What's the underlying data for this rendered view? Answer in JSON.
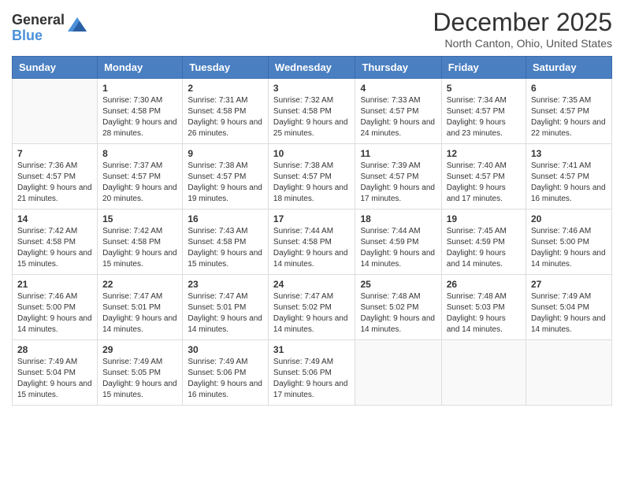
{
  "logo": {
    "general": "General",
    "blue": "Blue"
  },
  "title": "December 2025",
  "location": "North Canton, Ohio, United States",
  "days_of_week": [
    "Sunday",
    "Monday",
    "Tuesday",
    "Wednesday",
    "Thursday",
    "Friday",
    "Saturday"
  ],
  "weeks": [
    [
      {
        "day": "",
        "sunrise": "",
        "sunset": "",
        "daylight": ""
      },
      {
        "day": "1",
        "sunrise": "7:30 AM",
        "sunset": "4:58 PM",
        "daylight": "9 hours and 28 minutes."
      },
      {
        "day": "2",
        "sunrise": "7:31 AM",
        "sunset": "4:58 PM",
        "daylight": "9 hours and 26 minutes."
      },
      {
        "day": "3",
        "sunrise": "7:32 AM",
        "sunset": "4:58 PM",
        "daylight": "9 hours and 25 minutes."
      },
      {
        "day": "4",
        "sunrise": "7:33 AM",
        "sunset": "4:57 PM",
        "daylight": "9 hours and 24 minutes."
      },
      {
        "day": "5",
        "sunrise": "7:34 AM",
        "sunset": "4:57 PM",
        "daylight": "9 hours and 23 minutes."
      },
      {
        "day": "6",
        "sunrise": "7:35 AM",
        "sunset": "4:57 PM",
        "daylight": "9 hours and 22 minutes."
      }
    ],
    [
      {
        "day": "7",
        "sunrise": "7:36 AM",
        "sunset": "4:57 PM",
        "daylight": "9 hours and 21 minutes."
      },
      {
        "day": "8",
        "sunrise": "7:37 AM",
        "sunset": "4:57 PM",
        "daylight": "9 hours and 20 minutes."
      },
      {
        "day": "9",
        "sunrise": "7:38 AM",
        "sunset": "4:57 PM",
        "daylight": "9 hours and 19 minutes."
      },
      {
        "day": "10",
        "sunrise": "7:38 AM",
        "sunset": "4:57 PM",
        "daylight": "9 hours and 18 minutes."
      },
      {
        "day": "11",
        "sunrise": "7:39 AM",
        "sunset": "4:57 PM",
        "daylight": "9 hours and 17 minutes."
      },
      {
        "day": "12",
        "sunrise": "7:40 AM",
        "sunset": "4:57 PM",
        "daylight": "9 hours and 17 minutes."
      },
      {
        "day": "13",
        "sunrise": "7:41 AM",
        "sunset": "4:57 PM",
        "daylight": "9 hours and 16 minutes."
      }
    ],
    [
      {
        "day": "14",
        "sunrise": "7:42 AM",
        "sunset": "4:58 PM",
        "daylight": "9 hours and 15 minutes."
      },
      {
        "day": "15",
        "sunrise": "7:42 AM",
        "sunset": "4:58 PM",
        "daylight": "9 hours and 15 minutes."
      },
      {
        "day": "16",
        "sunrise": "7:43 AM",
        "sunset": "4:58 PM",
        "daylight": "9 hours and 15 minutes."
      },
      {
        "day": "17",
        "sunrise": "7:44 AM",
        "sunset": "4:58 PM",
        "daylight": "9 hours and 14 minutes."
      },
      {
        "day": "18",
        "sunrise": "7:44 AM",
        "sunset": "4:59 PM",
        "daylight": "9 hours and 14 minutes."
      },
      {
        "day": "19",
        "sunrise": "7:45 AM",
        "sunset": "4:59 PM",
        "daylight": "9 hours and 14 minutes."
      },
      {
        "day": "20",
        "sunrise": "7:46 AM",
        "sunset": "5:00 PM",
        "daylight": "9 hours and 14 minutes."
      }
    ],
    [
      {
        "day": "21",
        "sunrise": "7:46 AM",
        "sunset": "5:00 PM",
        "daylight": "9 hours and 14 minutes."
      },
      {
        "day": "22",
        "sunrise": "7:47 AM",
        "sunset": "5:01 PM",
        "daylight": "9 hours and 14 minutes."
      },
      {
        "day": "23",
        "sunrise": "7:47 AM",
        "sunset": "5:01 PM",
        "daylight": "9 hours and 14 minutes."
      },
      {
        "day": "24",
        "sunrise": "7:47 AM",
        "sunset": "5:02 PM",
        "daylight": "9 hours and 14 minutes."
      },
      {
        "day": "25",
        "sunrise": "7:48 AM",
        "sunset": "5:02 PM",
        "daylight": "9 hours and 14 minutes."
      },
      {
        "day": "26",
        "sunrise": "7:48 AM",
        "sunset": "5:03 PM",
        "daylight": "9 hours and 14 minutes."
      },
      {
        "day": "27",
        "sunrise": "7:49 AM",
        "sunset": "5:04 PM",
        "daylight": "9 hours and 14 minutes."
      }
    ],
    [
      {
        "day": "28",
        "sunrise": "7:49 AM",
        "sunset": "5:04 PM",
        "daylight": "9 hours and 15 minutes."
      },
      {
        "day": "29",
        "sunrise": "7:49 AM",
        "sunset": "5:05 PM",
        "daylight": "9 hours and 15 minutes."
      },
      {
        "day": "30",
        "sunrise": "7:49 AM",
        "sunset": "5:06 PM",
        "daylight": "9 hours and 16 minutes."
      },
      {
        "day": "31",
        "sunrise": "7:49 AM",
        "sunset": "5:06 PM",
        "daylight": "9 hours and 17 minutes."
      },
      {
        "day": "",
        "sunrise": "",
        "sunset": "",
        "daylight": ""
      },
      {
        "day": "",
        "sunrise": "",
        "sunset": "",
        "daylight": ""
      },
      {
        "day": "",
        "sunrise": "",
        "sunset": "",
        "daylight": ""
      }
    ]
  ],
  "labels": {
    "sunrise": "Sunrise:",
    "sunset": "Sunset:",
    "daylight": "Daylight:"
  }
}
